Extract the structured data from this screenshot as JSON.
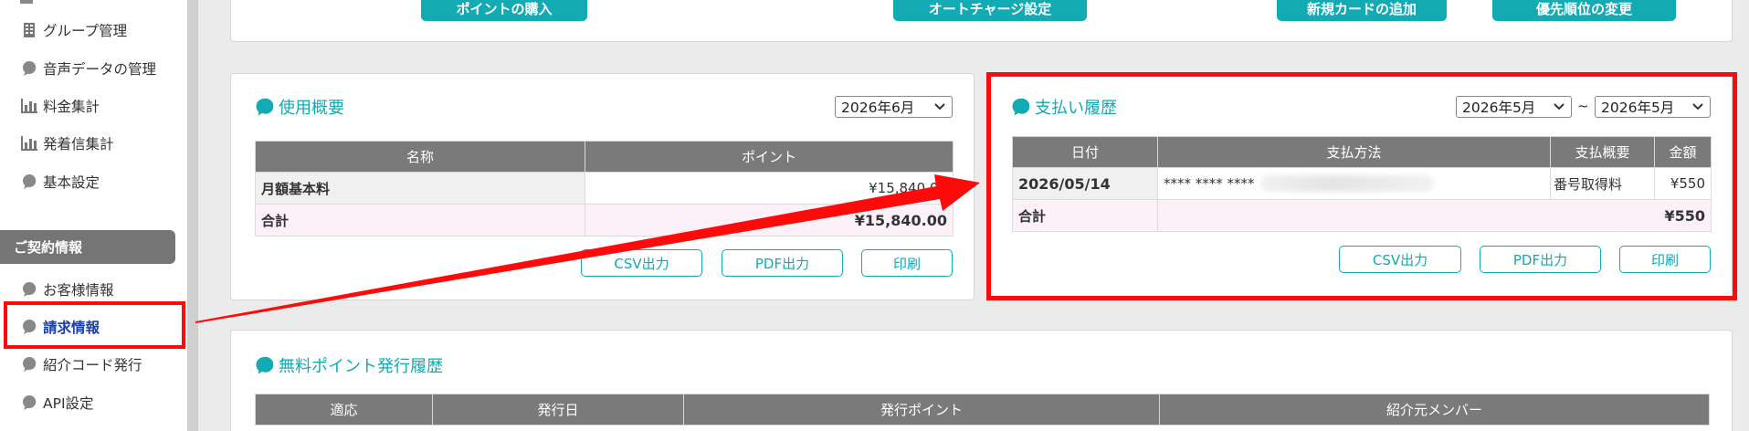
{
  "sidebar": {
    "items": [
      {
        "label": "グループ管理",
        "icon": "building-icon"
      },
      {
        "label": "音声データの管理",
        "icon": "speech-bubble-icon"
      },
      {
        "label": "料金集計",
        "icon": "bar-chart-icon"
      },
      {
        "label": "発着信集計",
        "icon": "bar-chart-icon"
      },
      {
        "label": "基本設定",
        "icon": "speech-bubble-icon"
      }
    ],
    "section_title": "ご契約情報",
    "section_items": [
      {
        "label": "お客様情報",
        "icon": "speech-bubble-icon"
      },
      {
        "label": "請求情報",
        "icon": "speech-bubble-icon",
        "active": true
      },
      {
        "label": "紹介コード発行",
        "icon": "speech-bubble-icon"
      },
      {
        "label": "API設定",
        "icon": "speech-bubble-icon"
      }
    ]
  },
  "top_buttons": {
    "buy_points": "ポイントの購入",
    "auto_charge": "オートチャージ設定",
    "add_card": "新規カードの追加",
    "change_priority": "優先順位の変更"
  },
  "usage": {
    "title": "使用概要",
    "month_select": "2026年6月",
    "columns": [
      "名称",
      "ポイント"
    ],
    "rows": [
      {
        "name": "月額基本料",
        "points": "¥15,840.00"
      }
    ],
    "total": {
      "name": "合計",
      "points": "¥15,840.00"
    },
    "buttons": {
      "csv": "CSV出力",
      "pdf": "PDF出力",
      "print": "印刷"
    }
  },
  "payments": {
    "title": "支払い履歴",
    "from_select": "2026年5月",
    "separator": "~",
    "to_select": "2026年5月",
    "columns": [
      "日付",
      "支払方法",
      "支払概要",
      "金額"
    ],
    "rows": [
      {
        "date": "2026/05/14",
        "method": "**** **** ****",
        "summary": "番号取得料",
        "amount": "¥550"
      }
    ],
    "total": {
      "label": "合計",
      "amount": "¥550"
    },
    "buttons": {
      "csv": "CSV出力",
      "pdf": "PDF出力",
      "print": "印刷"
    }
  },
  "free_points": {
    "title": "無料ポイント発行履歴",
    "columns": [
      "適応",
      "発行日",
      "発行ポイント",
      "紹介元メンバー"
    ]
  },
  "colors": {
    "accent": "#12aab3",
    "highlight": "#ff0a0a",
    "header": "#7a7a7a"
  }
}
